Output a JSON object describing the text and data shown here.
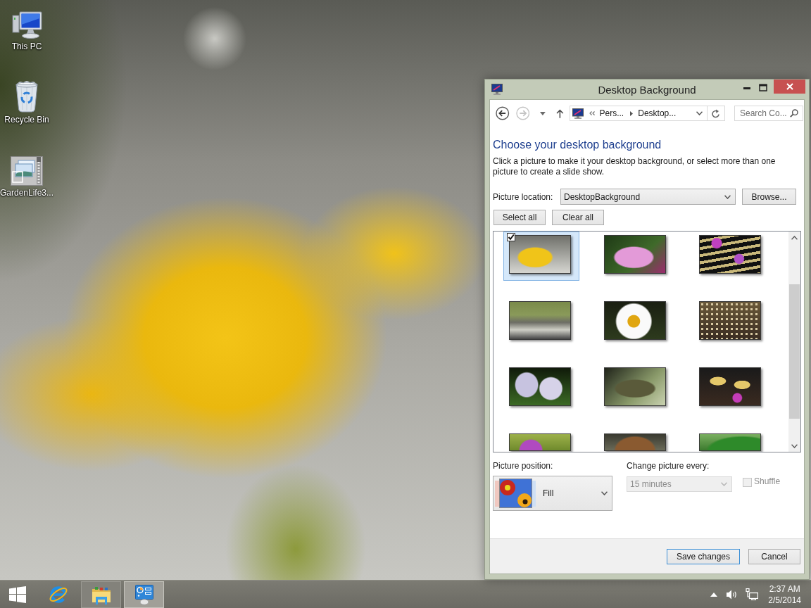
{
  "desktop_icons": [
    {
      "label": "This PC",
      "kind": "computer"
    },
    {
      "label": "Recycle Bin",
      "kind": "recycle-bin"
    },
    {
      "label": "GardenLife3...",
      "kind": "archive"
    }
  ],
  "window": {
    "title": "Desktop Background"
  },
  "nav": {
    "back": {
      "disabled": false
    },
    "forward": {
      "disabled": true
    },
    "breadcrumb": [
      "Pers...",
      "Desktop..."
    ],
    "search": {
      "placeholder": "Search Co..."
    }
  },
  "heading": "Choose your desktop background",
  "description": "Click a picture to make it your desktop background, or select more than one picture to create a slide show.",
  "picture_location": {
    "label": "Picture location:",
    "value": "DesktopBackground",
    "button": "Browse..."
  },
  "selection_buttons": [
    "Select all",
    "Clear all"
  ],
  "pictures": [
    {
      "selected": true,
      "checked": true
    },
    {
      "selected": false,
      "checked": false
    },
    {
      "selected": false,
      "checked": false
    },
    {
      "selected": false,
      "checked": false
    },
    {
      "selected": false,
      "checked": false
    },
    {
      "selected": false,
      "checked": false
    },
    {
      "selected": false,
      "checked": false
    },
    {
      "selected": false,
      "checked": false
    },
    {
      "selected": false,
      "checked": false
    },
    {
      "selected": false,
      "checked": false
    },
    {
      "selected": false,
      "checked": false
    },
    {
      "selected": false,
      "checked": false
    }
  ],
  "picture_position": {
    "label": "Picture position:",
    "value": "Fill"
  },
  "change_picture": {
    "label": "Change picture every:",
    "value": "15 minutes",
    "disabled": true
  },
  "shuffle": {
    "label": "Shuffle",
    "checked": false,
    "disabled": true
  },
  "footer_buttons": [
    {
      "label": "Save changes",
      "default": true
    },
    {
      "label": "Cancel",
      "default": false
    }
  ],
  "taskbar": {
    "apps": [
      {
        "kind": "browser",
        "running": false,
        "active": false
      },
      {
        "kind": "file-explorer",
        "running": true,
        "active": false
      },
      {
        "kind": "control-panel",
        "running": true,
        "active": true
      }
    ],
    "clock": {
      "time": "2:37 AM",
      "date": "2/5/2014"
    }
  }
}
